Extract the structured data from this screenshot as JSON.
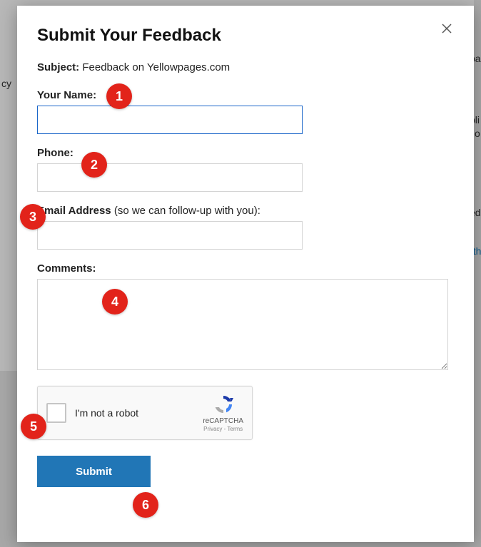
{
  "modal": {
    "title": "Submit Your Feedback",
    "subject_label": "Subject:",
    "subject_value": "Feedback on Yellowpages.com",
    "fields": {
      "name": {
        "label": "Your Name:",
        "value": ""
      },
      "phone": {
        "label": "Phone:",
        "value": ""
      },
      "email": {
        "label_bold": "Email Address",
        "label_hint": " (so we can follow-up with you):",
        "value": ""
      },
      "comments": {
        "label": "Comments:",
        "value": ""
      }
    },
    "recaptcha": {
      "label": "I'm not a robot",
      "brand": "reCAPTCHA",
      "privacy_terms": "Privacy - Terms"
    },
    "submit_label": "Submit"
  },
  "background": {
    "snippet_cy": "cy",
    "snippet_pa": "pa",
    "snippet_bli": "bli",
    "snippet_tio": "tio",
    "snippet_ed": "ed",
    "snippet_th": ", th"
  },
  "badges": [
    "1",
    "2",
    "3",
    "4",
    "5",
    "6"
  ]
}
